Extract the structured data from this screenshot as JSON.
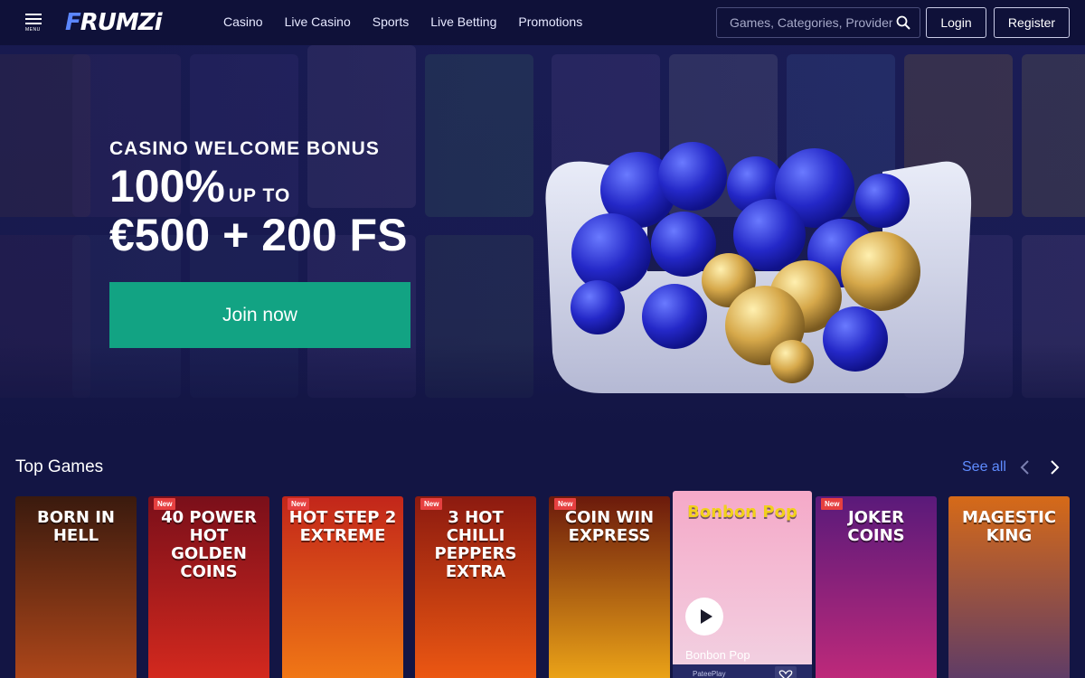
{
  "header": {
    "menu_label": "MENU",
    "logo_text": "FRUMZi",
    "nav": [
      "Casino",
      "Live Casino",
      "Sports",
      "Live Betting",
      "Promotions"
    ],
    "search_placeholder": "Games, Categories, Providers",
    "login_label": "Login",
    "register_label": "Register"
  },
  "hero": {
    "label": "CASINO WELCOME BONUS",
    "percent": "100%",
    "up_to": "UP TO",
    "amount": "€500 + 200 FS",
    "cta": "Join now"
  },
  "top_games": {
    "title": "Top Games",
    "see_all": "See all",
    "cards": [
      {
        "title": "BORN IN HELL",
        "new": false,
        "colors": [
          "#3a1a0e",
          "#b2481a"
        ]
      },
      {
        "title": "40 POWER HOT GOLDEN COINS",
        "new": true,
        "badge": "New",
        "colors": [
          "#7a0f1a",
          "#d72a1e"
        ]
      },
      {
        "title": "HOT STEP 2 EXTREME",
        "new": true,
        "badge": "New",
        "colors": [
          "#c2261a",
          "#f27a15"
        ]
      },
      {
        "title": "3 HOT CHILLI PEPPERS EXTRA",
        "new": true,
        "badge": "New",
        "colors": [
          "#8c1a10",
          "#f05a12"
        ]
      },
      {
        "title": "COIN WIN EXPRESS",
        "new": true,
        "badge": "New",
        "colors": [
          "#6b1a0c",
          "#f0a818"
        ]
      },
      {
        "title": "Bonbon Pop",
        "new": false,
        "active": true,
        "provider": "PateePlay",
        "colors": [
          "#f5a9c8",
          "#f2d3e3"
        ]
      },
      {
        "title": "JOKER COINS",
        "new": true,
        "badge": "New",
        "colors": [
          "#5a1a7a",
          "#c22a7a"
        ]
      },
      {
        "title": "MAGESTIC KING",
        "new": false,
        "colors": [
          "#d66a18",
          "#5a3a6a"
        ]
      }
    ]
  },
  "colors": {
    "background": "#131544",
    "header": "#0f1139",
    "cta": "#12a383",
    "link": "#5f8cff",
    "badge": "#e64040"
  }
}
